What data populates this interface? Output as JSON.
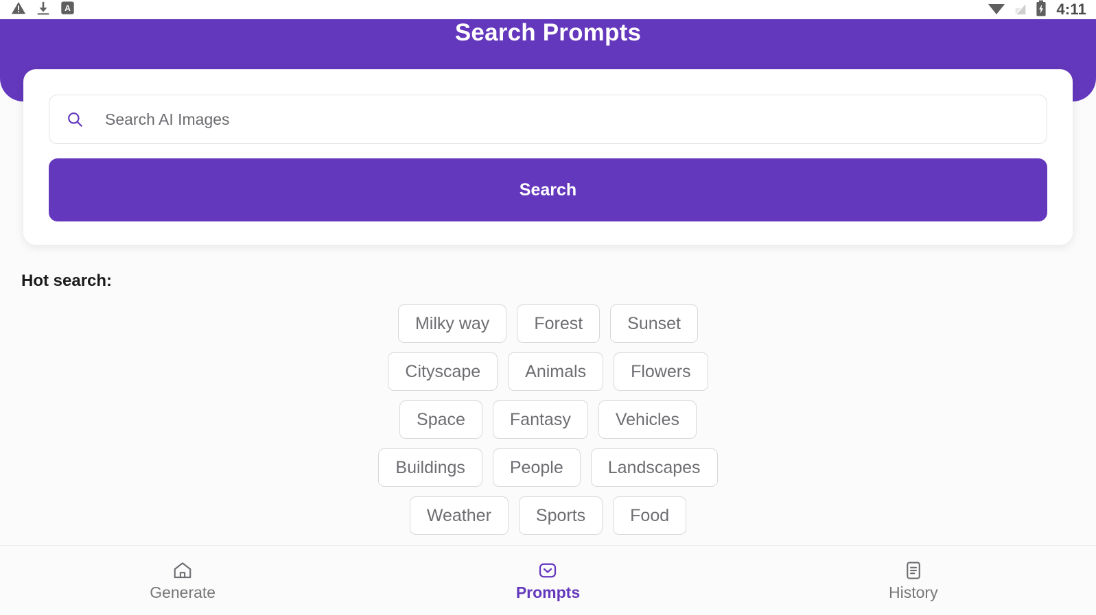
{
  "theme": {
    "primary": "#6438bd",
    "page_background": "#fbfbfb",
    "card_background": "#ffffff",
    "chip_border": "#d9d9dd",
    "chip_text": "#6d6d72",
    "nav_inactive": "#767676"
  },
  "status_bar": {
    "time": "4:11",
    "left_icons": [
      "warning-triangle-icon",
      "download-icon",
      "letter-a-badge-icon"
    ],
    "right_icons": [
      "wifi-icon",
      "sim-card-off-icon",
      "battery-charging-icon"
    ]
  },
  "header": {
    "title": "Search Prompts"
  },
  "search": {
    "placeholder": "Search AI Images",
    "value": "",
    "icon": "search-icon",
    "button_label": "Search"
  },
  "hot_search": {
    "label": "Hot search:",
    "rows": [
      [
        "Milky way",
        "Forest",
        "Sunset"
      ],
      [
        "Cityscape",
        "Animals",
        "Flowers"
      ],
      [
        "Space",
        "Fantasy",
        "Vehicles"
      ],
      [
        "Buildings",
        "People",
        "Landscapes"
      ],
      [
        "Weather",
        "Sports",
        "Food"
      ]
    ]
  },
  "bottom_nav": {
    "items": [
      {
        "label": "Generate",
        "icon": "home-icon",
        "active": false
      },
      {
        "label": "Prompts",
        "icon": "message-chevron-icon",
        "active": true
      },
      {
        "label": "History",
        "icon": "document-list-icon",
        "active": false
      }
    ]
  }
}
